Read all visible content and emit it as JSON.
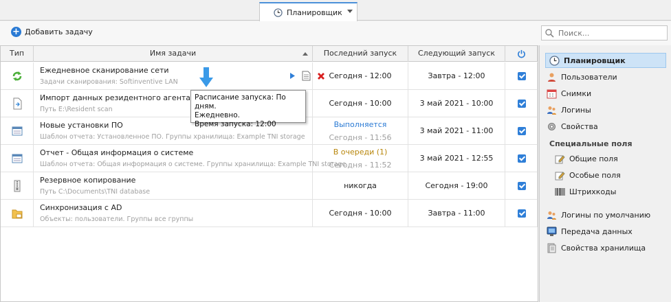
{
  "tab": {
    "label": "Планировщик"
  },
  "toolbar": {
    "add_label": "Добавить задачу",
    "search_placeholder": "Поиск..."
  },
  "columns": {
    "type": "Тип",
    "name": "Имя задачи",
    "last": "Последний запуск",
    "next": "Следующий запуск"
  },
  "rows": [
    {
      "name": "Ежедневное сканирование сети",
      "sub": "Задачи сканирования: Softinventive LAN",
      "last": "Сегодня - 12:00",
      "last2": "",
      "next": "Завтра - 12:00"
    },
    {
      "name": "Импорт данных резидентного агента",
      "sub": "Путь E:\\Resident scan",
      "last": "Сегодня - 10:00",
      "last2": "",
      "next": "3 май 2021 - 10:00"
    },
    {
      "name": "Новые установки ПО",
      "sub": "Шаблон отчета: Установленное ПО. Группы хранилища: Example TNI storage",
      "last": "Выполняется",
      "last2": "Сегодня - 11:56",
      "next": "3 май 2021 - 11:00"
    },
    {
      "name": "Отчет - Общая информация о системе",
      "sub": "Шаблон отчета: Общая информация о системе. Группы хранилища: Example TNI storage",
      "last": "В очереди (1)",
      "last2": "Сегодня - 11:52",
      "next": "3 май 2021 - 12:55"
    },
    {
      "name": "Резервное копирование",
      "sub": "Путь C:\\Documents\\TNI database",
      "last": "никогда",
      "last2": "",
      "next": "Сегодня - 19:00"
    },
    {
      "name": "Синхронизация с AD",
      "sub": "Объекты: пользователи. Группы все группы",
      "last": "Сегодня - 10:00",
      "last2": "",
      "next": "Завтра - 11:00"
    }
  ],
  "tooltip": {
    "line1": "Расписание запуска: По дням.",
    "line2": "Ежедневно.",
    "line3": "Время запуска: 12:00"
  },
  "sidebar": {
    "items": [
      "Планировщик",
      "Пользователи",
      "Снимки",
      "Логины",
      "Свойства"
    ],
    "special_header": "Специальные поля",
    "special": [
      "Общие поля",
      "Особые поля",
      "Штрихкоды"
    ],
    "extra": [
      "Логины по умолчанию",
      "Передача данных",
      "Свойства хранилища"
    ]
  },
  "colors": {
    "accent": "#2f7fd8",
    "running": "#2a7ad4",
    "queued": "#b8860b",
    "delete": "#d81f1f"
  }
}
